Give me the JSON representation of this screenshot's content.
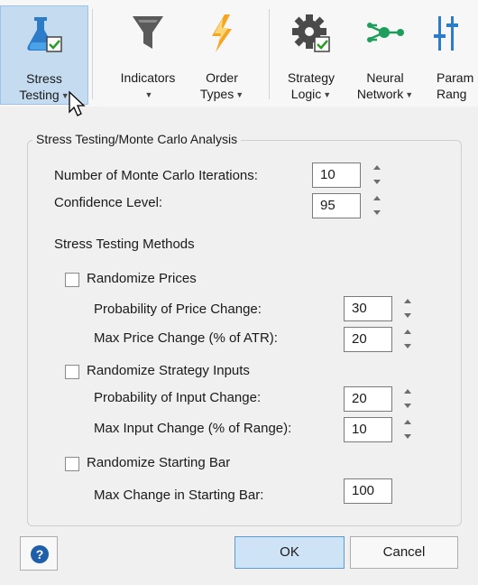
{
  "ribbon": {
    "items": [
      {
        "l1": "Stress",
        "l2": "Testing",
        "icon": "flask-check-icon"
      },
      {
        "l1": "Indicators",
        "l2": "",
        "icon": "funnel-icon"
      },
      {
        "l1": "Order",
        "l2": "Types",
        "icon": "lightning-icon"
      },
      {
        "l1": "Strategy",
        "l2": "Logic",
        "icon": "gear-check-icon"
      },
      {
        "l1": "Neural",
        "l2": "Network",
        "icon": "neural-network-icon"
      },
      {
        "l1": "Param",
        "l2": "Rang",
        "icon": "sliders-icon"
      }
    ]
  },
  "dialog": {
    "group_title": "Stress Testing/Monte Carlo Analysis",
    "mc_iterations_label": "Number of Monte Carlo Iterations:",
    "mc_iterations_value": "10",
    "confidence_label": "Confidence Level:",
    "confidence_value": "95",
    "methods_label": "Stress Testing Methods",
    "randomize_prices_label": "Randomize Prices",
    "randomize_prices_checked": false,
    "prob_price_label": "Probability of Price Change:",
    "prob_price_value": "30",
    "max_price_label": "Max Price Change (% of ATR):",
    "max_price_value": "20",
    "randomize_inputs_label": "Randomize Strategy Inputs",
    "randomize_inputs_checked": false,
    "prob_input_label": "Probability of Input Change:",
    "prob_input_value": "20",
    "max_input_label": "Max Input Change (% of Range):",
    "max_input_value": "10",
    "randomize_start_label": "Randomize Starting Bar",
    "randomize_start_checked": false,
    "max_start_label": "Max Change in Starting Bar:",
    "max_start_value": "100",
    "ok_label": "OK",
    "cancel_label": "Cancel",
    "help_glyph": "?"
  },
  "colors": {
    "accent": "#5b9bd5",
    "active_ribbon": "#c5dcf0",
    "help": "#1f5ea8"
  }
}
